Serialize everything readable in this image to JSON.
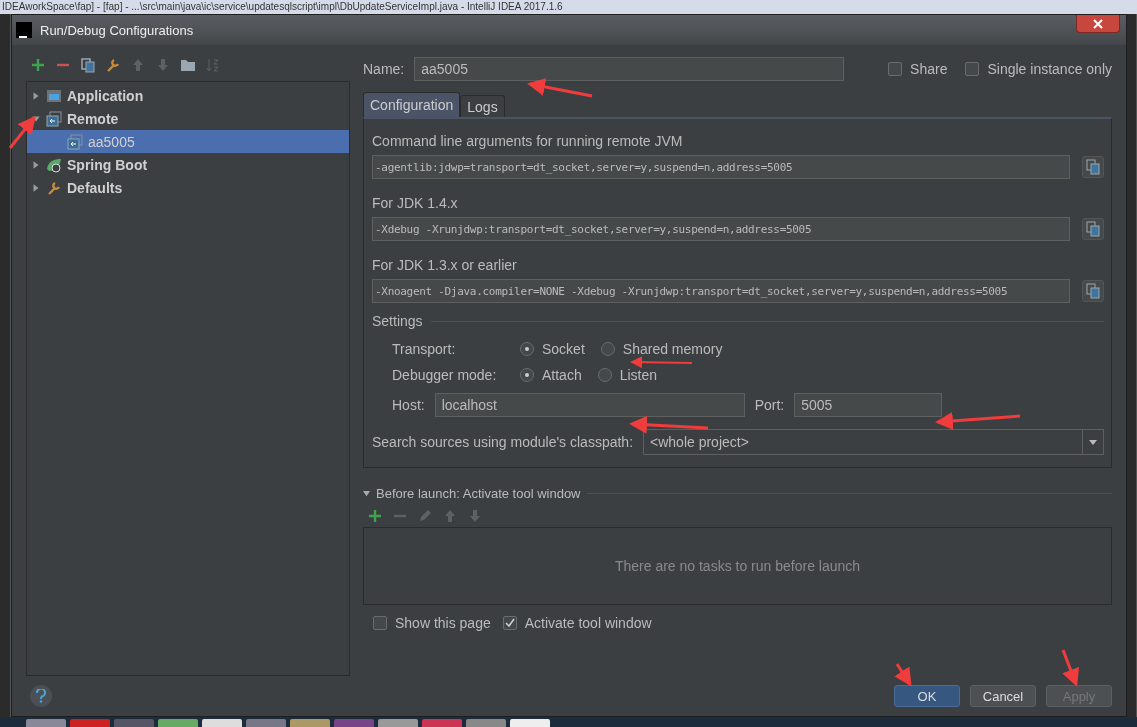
{
  "background_window": {
    "title": "IDEAworkSpace\\fap] - [fap] - ...\\src\\main\\java\\ic\\service\\updatesqlscript\\impl\\DbUpdateServiceImpl.java - IntelliJ IDEA 2017.1.6"
  },
  "dialog": {
    "title": "Run/Debug Configurations"
  },
  "toolbar": [
    {
      "kind": "add",
      "disabled": false
    },
    {
      "kind": "remove",
      "disabled": false
    },
    {
      "kind": "copy",
      "disabled": false
    },
    {
      "kind": "wrench",
      "disabled": false
    },
    {
      "kind": "up",
      "disabled": true
    },
    {
      "kind": "down",
      "disabled": true
    },
    {
      "kind": "folder",
      "disabled": false
    },
    {
      "kind": "sort",
      "disabled": true
    }
  ],
  "tree": [
    {
      "label": "Application",
      "kind": "application",
      "expanded": false,
      "selected": false
    },
    {
      "label": "Remote",
      "kind": "remote",
      "expanded": true,
      "selected": false,
      "children": [
        {
          "label": "aa5005",
          "kind": "remote",
          "selected": true
        }
      ]
    },
    {
      "label": "Spring Boot",
      "kind": "spring",
      "expanded": false,
      "selected": false
    },
    {
      "label": "Defaults",
      "kind": "wrench",
      "expanded": false,
      "selected": false
    }
  ],
  "name": {
    "label": "Name:",
    "value": "aa5005"
  },
  "options": [
    {
      "label": "Share",
      "checked": false
    },
    {
      "label": "Single instance only",
      "checked": false
    }
  ],
  "tabs": [
    {
      "label": "Configuration",
      "selected": true
    },
    {
      "label": "Logs",
      "selected": false
    }
  ],
  "arguments": [
    {
      "label": "Command line arguments for running remote JVM",
      "value": "-agentlib:jdwp=transport=dt_socket,server=y,suspend=n,address=5005"
    },
    {
      "label": "For JDK 1.4.x",
      "value": "-Xdebug -Xrunjdwp:transport=dt_socket,server=y,suspend=n,address=5005"
    },
    {
      "label": "For JDK 1.3.x or earlier",
      "value": "-Xnoagent -Djava.compiler=NONE -Xdebug -Xrunjdwp:transport=dt_socket,server=y,suspend=n,address=5005"
    }
  ],
  "settings": {
    "title": "Settings",
    "radio_groups": [
      {
        "label": "Transport:",
        "options": [
          {
            "label": "Socket",
            "selected": true
          },
          {
            "label": "Shared memory",
            "selected": false
          }
        ]
      },
      {
        "label": "Debugger mode:",
        "options": [
          {
            "label": "Attach",
            "selected": true
          },
          {
            "label": "Listen",
            "selected": false
          }
        ]
      }
    ],
    "host": {
      "label": "Host:",
      "value": "localhost"
    },
    "port": {
      "label": "Port:",
      "value": "5005"
    },
    "classpath": {
      "label": "Search sources using module's classpath:",
      "value": "<whole project>"
    }
  },
  "before_launch": {
    "title": "Before launch: Activate tool window",
    "expanded": true,
    "toolbar": [
      {
        "kind": "add",
        "disabled": false
      },
      {
        "kind": "remove",
        "disabled": true
      },
      {
        "kind": "edit",
        "disabled": true
      },
      {
        "kind": "up",
        "disabled": true
      },
      {
        "kind": "down",
        "disabled": true
      }
    ],
    "empty_text": "There are no tasks to run before launch",
    "checkboxes": [
      {
        "label": "Show this page",
        "checked": false
      },
      {
        "label": "Activate tool window",
        "checked": true
      }
    ]
  },
  "buttons": [
    {
      "label": "OK",
      "default": true,
      "disabled": false
    },
    {
      "label": "Cancel",
      "default": false,
      "disabled": false
    },
    {
      "label": "Apply",
      "default": false,
      "disabled": true
    }
  ]
}
